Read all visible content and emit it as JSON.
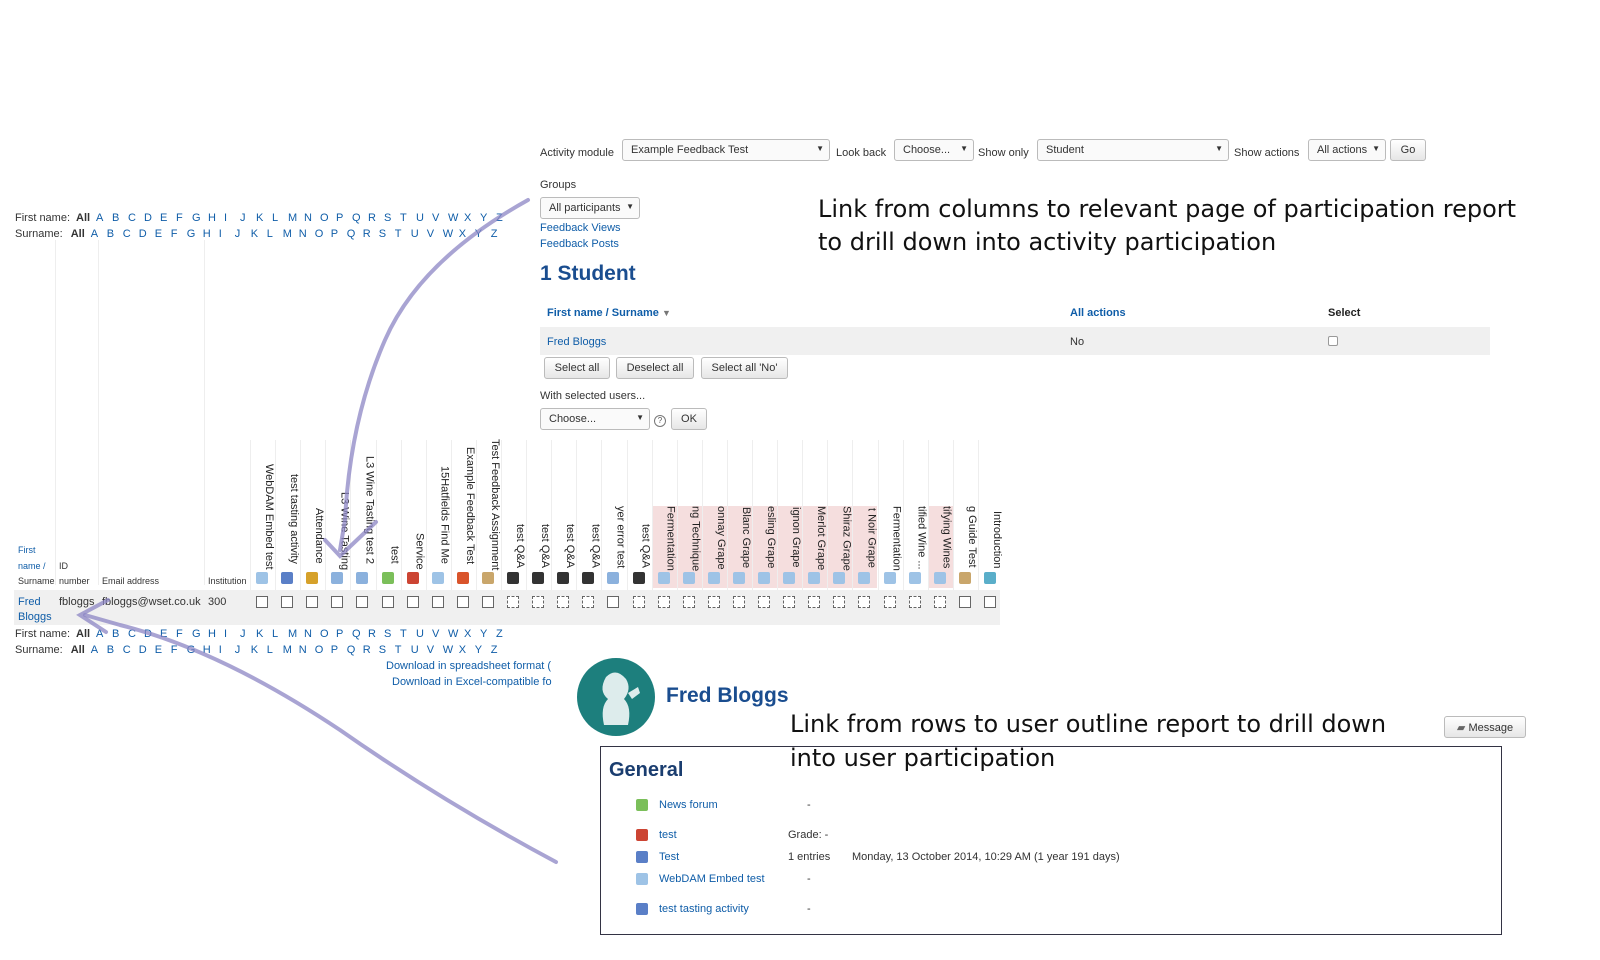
{
  "filters": {
    "activity_module_label": "Activity module",
    "activity_module_value": "Example Feedback Test",
    "look_back_label": "Look back",
    "look_back_value": "Choose...",
    "show_only_label": "Show only",
    "show_only_value": "Student",
    "show_actions_label": "Show actions",
    "show_actions_value": "All actions",
    "go_label": "Go"
  },
  "groups": {
    "label": "Groups",
    "value": "All participants",
    "links": [
      "Feedback Views",
      "Feedback Posts"
    ]
  },
  "students": {
    "heading": "1 Student",
    "col_name": "First name / Surname",
    "col_actions": "All actions",
    "col_select": "Select",
    "row_name": "Fred Bloggs",
    "row_actions": "No",
    "select_all": "Select all",
    "deselect_all": "Deselect all",
    "select_no": "Select all 'No'",
    "with_selected": "With selected users...",
    "choose": "Choose...",
    "ok": "OK"
  },
  "alphabet": {
    "first_label": "First name:",
    "surname_label": "Surname:",
    "all": "All",
    "letters": [
      "A",
      "B",
      "C",
      "D",
      "E",
      "F",
      "G",
      "H",
      "I",
      "J",
      "K",
      "L",
      "M",
      "N",
      "O",
      "P",
      "Q",
      "R",
      "S",
      "T",
      "U",
      "V",
      "W",
      "X",
      "Y",
      "Z"
    ]
  },
  "annotations": {
    "top_line1": "Link from columns to relevant page of participation report",
    "top_line2": "to drill down into activity participation",
    "bottom_line1": "Link from rows to user outline report to drill down",
    "bottom_line2": "into user participation"
  },
  "grid": {
    "head_first1": "First",
    "head_first2": "name /",
    "head_surname": "Surname",
    "head_id1": "ID",
    "head_id2": "number",
    "head_email": "Email address",
    "head_inst": "Institution",
    "row_first": "Fred",
    "row_last": "Bloggs",
    "row_id": "fbloggs",
    "row_email": "fbloggs@wset.co.uk",
    "row_inst": "300",
    "columns": [
      {
        "label": "WebDAM Embed test",
        "pink": false,
        "dash": false,
        "color": "#9ec3e6"
      },
      {
        "label": "test tasting activity",
        "pink": false,
        "dash": false,
        "color": "#5a7fc7"
      },
      {
        "label": "Attendance",
        "pink": false,
        "dash": false,
        "color": "#d6a12a"
      },
      {
        "label": "L3 Wine Tasting",
        "pink": false,
        "dash": false,
        "color": "#8bb1dd"
      },
      {
        "label": "L3 Wine Tasting test 2",
        "pink": false,
        "dash": false,
        "color": "#8bb1dd"
      },
      {
        "label": "test",
        "pink": false,
        "dash": false,
        "color": "#7bbf5a"
      },
      {
        "label": "Service",
        "pink": false,
        "dash": false,
        "color": "#cc4433"
      },
      {
        "label": "15Hatfields Find Me",
        "pink": false,
        "dash": false,
        "color": "#9ec3e6"
      },
      {
        "label": "Example Feedback Test",
        "pink": false,
        "dash": false,
        "color": "#d9542b"
      },
      {
        "label": "Test Feedback Assignment",
        "pink": false,
        "dash": false,
        "color": "#c9a66b"
      },
      {
        "label": "test Q&A",
        "pink": false,
        "dash": true,
        "color": "#333333"
      },
      {
        "label": "test Q&A",
        "pink": false,
        "dash": true,
        "color": "#333333"
      },
      {
        "label": "test Q&A",
        "pink": false,
        "dash": true,
        "color": "#333333"
      },
      {
        "label": "test Q&A",
        "pink": false,
        "dash": true,
        "color": "#333333"
      },
      {
        "label": "yer error test",
        "pink": false,
        "dash": false,
        "color": "#8bb1dd"
      },
      {
        "label": "test Q&A",
        "pink": false,
        "dash": true,
        "color": "#333333"
      },
      {
        "label": "Fermentation",
        "pink": true,
        "dash": true,
        "color": "#9ec3e6"
      },
      {
        "label": "ng Technique",
        "pink": true,
        "dash": true,
        "color": "#9ec3e6"
      },
      {
        "label": "onnay Grape",
        "pink": true,
        "dash": true,
        "color": "#9ec3e6"
      },
      {
        "label": "Blanc Grape",
        "pink": true,
        "dash": true,
        "color": "#9ec3e6"
      },
      {
        "label": "esling Grape",
        "pink": true,
        "dash": true,
        "color": "#9ec3e6"
      },
      {
        "label": "ignon Grape",
        "pink": true,
        "dash": true,
        "color": "#9ec3e6"
      },
      {
        "label": "Merlot Grape",
        "pink": true,
        "dash": true,
        "color": "#9ec3e6"
      },
      {
        "label": "Shiraz Grape",
        "pink": true,
        "dash": true,
        "color": "#9ec3e6"
      },
      {
        "label": "t Noir Grape",
        "pink": true,
        "dash": true,
        "color": "#9ec3e6"
      },
      {
        "label": "Fermentation",
        "pink": false,
        "dash": true,
        "color": "#9ec3e6"
      },
      {
        "label": "tified Wine ...",
        "pink": false,
        "dash": true,
        "color": "#9ec3e6"
      },
      {
        "label": "tifying Wines",
        "pink": true,
        "dash": true,
        "color": "#9ec3e6"
      },
      {
        "label": "g Guide Test",
        "pink": false,
        "dash": false,
        "color": "#c9a66b"
      },
      {
        "label": "Introduction",
        "pink": false,
        "dash": false,
        "color": "#5aaec9"
      }
    ],
    "download1": "Download in spreadsheet format (",
    "download2": "Download in Excel-compatible fo"
  },
  "profile": {
    "name": "Fred Bloggs",
    "message": "Message",
    "section": "General",
    "items": [
      {
        "name": "News forum",
        "grade": "-",
        "extra": "",
        "color": "#7bbf5a"
      },
      {
        "name": "test",
        "grade": "Grade: -",
        "extra": "",
        "color": "#cc4433"
      },
      {
        "name": "Test",
        "grade": "1 entries",
        "extra": "Monday, 13 October 2014, 10:29 AM (1 year 191 days)",
        "color": "#5a7fc7"
      },
      {
        "name": "WebDAM Embed test",
        "grade": "-",
        "extra": "",
        "color": "#9ec3e6"
      },
      {
        "name": "test tasting activity",
        "grade": "-",
        "extra": "",
        "color": "#5a7fc7"
      }
    ]
  }
}
